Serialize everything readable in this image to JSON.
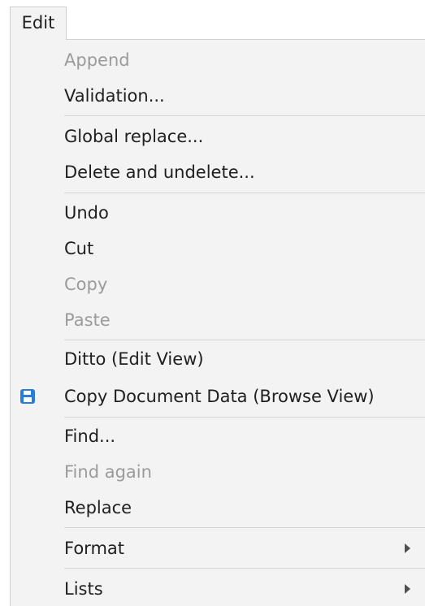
{
  "menubar": {
    "edit_label": "Edit"
  },
  "colors": {
    "background": "#f3f3f3",
    "text": "#202020",
    "disabled_text": "#9b9b9b",
    "icon_blue": "#2b7bd8"
  },
  "menu": {
    "items": [
      {
        "label": "Append",
        "enabled": false
      },
      {
        "label": "Validation...",
        "enabled": true
      },
      {
        "label": "Global replace...",
        "enabled": true
      },
      {
        "label": "Delete and undelete...",
        "enabled": true
      },
      {
        "label": "Undo",
        "enabled": true
      },
      {
        "label": "Cut",
        "enabled": true
      },
      {
        "label": "Copy",
        "enabled": false
      },
      {
        "label": "Paste",
        "enabled": false
      },
      {
        "label": "Ditto (Edit View)",
        "enabled": true
      },
      {
        "label": "Copy Document Data (Browse View)",
        "enabled": true,
        "icon": "save-disk-icon"
      },
      {
        "label": "Find...",
        "enabled": true
      },
      {
        "label": "Find again",
        "enabled": false
      },
      {
        "label": "Replace",
        "enabled": true
      },
      {
        "label": "Format",
        "enabled": true,
        "submenu": true
      },
      {
        "label": "Lists",
        "enabled": true,
        "submenu": true
      }
    ]
  }
}
